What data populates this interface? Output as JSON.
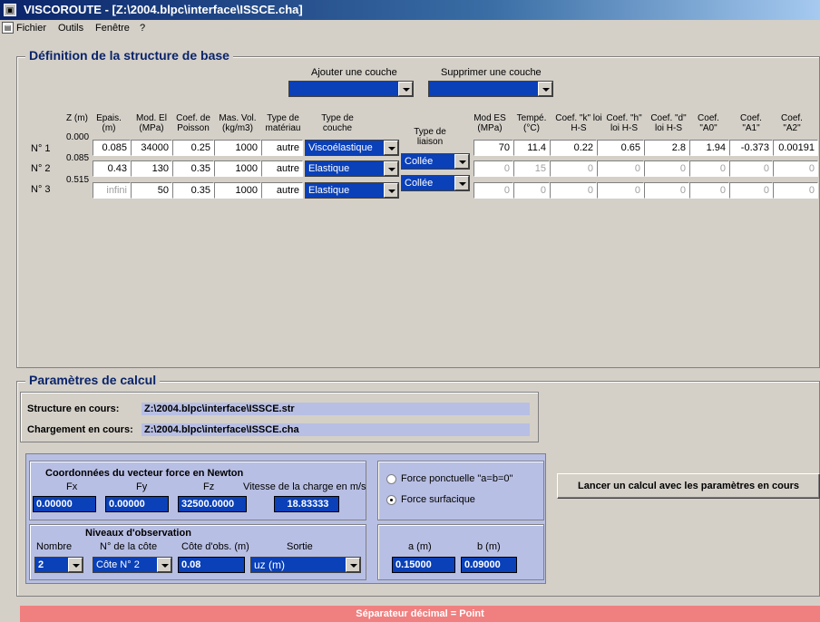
{
  "window": {
    "title": "VISCOROUTE - [Z:\\2004.blpc\\interface\\ISSCE.cha]"
  },
  "menu": {
    "items": [
      "Fichier",
      "Outils",
      "Fenêtre",
      "?"
    ]
  },
  "structure": {
    "title": "Définition de la structure de  base",
    "add_layer_label": "Ajouter une couche",
    "remove_layer_label": "Supprimer une couche",
    "add_layer_value": "",
    "remove_layer_value": "",
    "headers": {
      "z": "Z (m)",
      "epais": "Epais. (m)",
      "mod": "Mod. El (MPa)",
      "poisson": "Coef. de Poisson",
      "mas": "Mas. Vol. (kg/m3)",
      "mat": "Type de matériau",
      "couche": "Type de couche",
      "liaison": "Type de liaison",
      "modes": "Mod ES (MPa)",
      "temp": "Tempé. (°C)",
      "k": "Coef. \"k\" loi H-S",
      "h": "Coef. \"h\" loi H-S",
      "d": "Coef. \"d\" loi H-S",
      "a0": "Coef. \"A0\"",
      "a1": "Coef. \"A1\"",
      "a2": "Coef. \"A2\""
    },
    "z_values": [
      "0.000",
      "0.085",
      "0.515"
    ],
    "rows": [
      {
        "name": "N° 1",
        "epais": "0.085",
        "mod": "34000",
        "poisson": "0.25",
        "mas": "1000",
        "mat": "autre",
        "couche": "Viscoélastique",
        "modes": "70",
        "temp": "11.4",
        "k": "0.22",
        "h": "0.65",
        "d": "2.8",
        "a0": "1.94",
        "a1": "-0.373",
        "a2": "0.00191"
      },
      {
        "name": "N° 2",
        "epais": "0.43",
        "mod": "130",
        "poisson": "0.35",
        "mas": "1000",
        "mat": "autre",
        "couche": "Elastique",
        "modes": "0",
        "temp": "15",
        "k": "0",
        "h": "0",
        "d": "0",
        "a0": "0",
        "a1": "0",
        "a2": "0"
      },
      {
        "name": "N° 3",
        "epais": "infini",
        "mod": "50",
        "poisson": "0.35",
        "mas": "1000",
        "mat": "autre",
        "couche": "Elastique",
        "modes": "0",
        "temp": "0",
        "k": "0",
        "h": "0",
        "d": "0",
        "a0": "0",
        "a1": "0",
        "a2": "0"
      }
    ],
    "liaisons": [
      "Collée",
      "Collée"
    ]
  },
  "calcul": {
    "title": "Paramètres de calcul",
    "structure_label": "Structure en cours:",
    "structure_path": "Z:\\2004.blpc\\interface\\ISSCE.str",
    "chargement_label": "Chargement en cours:",
    "chargement_path": "Z:\\2004.blpc\\interface\\ISSCE.cha",
    "force_title": "Coordonnées du vecteur force en Newton",
    "fx_label": "Fx",
    "fy_label": "Fy",
    "fz_label": "Fz",
    "vitesse_label": "Vitesse de la charge en m/s",
    "fx": "0.00000",
    "fy": "0.00000",
    "fz": "32500.0000",
    "vitesse": "18.83333",
    "radio_ponctuelle": "Force ponctuelle \"a=b=0\"",
    "radio_surfacique": "Force surfacique",
    "niveaux_title": "Niveaux d'observation",
    "nombre_label": "Nombre",
    "cote_label": "N° de la côte",
    "cote_obs_label": "Côte d'obs. (m)",
    "sortie_label": "Sortie",
    "nombre": "2",
    "cote": "Côte N° 2",
    "cote_obs": "0.08",
    "sortie": "uz (m)",
    "a_label": "a (m)",
    "b_label": "b (m)",
    "a": "0.15000",
    "b": "0.09000",
    "launch_button": "Lancer un calcul avec les paramètres en cours"
  },
  "status": {
    "text": "Séparateur décimal = Point"
  }
}
